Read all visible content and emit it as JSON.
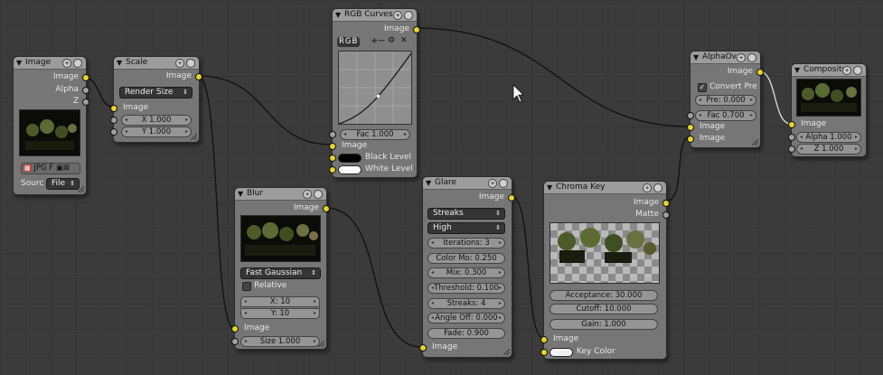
{
  "colors": {
    "socket_image": "#e8d22e",
    "socket_value": "#a0a0a0",
    "node_body": "#767676",
    "node_header": "#9c9c9c",
    "canvas": "#3b3b3b",
    "wire": "#111111"
  },
  "image": {
    "title": "Image",
    "out_image": "Image",
    "out_alpha": "Alpha",
    "out_z": "Z",
    "format": "JPG",
    "f_btn": "F",
    "source_label": "Sourc",
    "source_value": "File"
  },
  "scale": {
    "title": "Scale",
    "out_image": "Image",
    "mode": "Render Size",
    "in_image": "Image",
    "x": "X 1.000",
    "y": "Y 1.000"
  },
  "rgb": {
    "title": "RGB Curves",
    "out_image": "Image",
    "tab_rgb": "RGB",
    "fac": "Fac 1.000",
    "in_image": "Image",
    "black": "Black Level",
    "white": "White Level"
  },
  "blur": {
    "title": "Blur",
    "out_image": "Image",
    "type": "Fast Gaussian",
    "relative": "Relative",
    "x": "X: 10",
    "y": "Y: 10",
    "in_image": "Image",
    "size": "Size 1.000"
  },
  "glare": {
    "title": "Glare",
    "out_image": "Image",
    "type": "Streaks",
    "quality": "High",
    "iterations": "Iterations: 3",
    "color_mod": "Color Mo: 0.250",
    "mix": "Mix: 0.300",
    "threshold": "Threshold: 0.100",
    "streaks": "Streaks: 4",
    "angle": "Angle Off: 0.000",
    "fade": "Fade: 0.900",
    "in_image": "Image"
  },
  "chroma": {
    "title": "Chroma Key",
    "out_image": "Image",
    "out_matte": "Matte",
    "acceptance": "Acceptance: 30.000",
    "cutoff": "Cutoff: 10.000",
    "gain": "Gain: 1.000",
    "in_image": "Image",
    "key_color": "Key Color"
  },
  "alphaover": {
    "title": "AlphaOv",
    "out_image": "Image",
    "convert": "Convert Pre",
    "pre": "Pre: 0.000",
    "fac": "Fac 0.700",
    "in_image1": "Image",
    "in_image2": "Image"
  },
  "composite": {
    "title": "Composite",
    "in_image": "Image",
    "alpha": "Alpha 1.000",
    "z": "Z 1.000"
  }
}
